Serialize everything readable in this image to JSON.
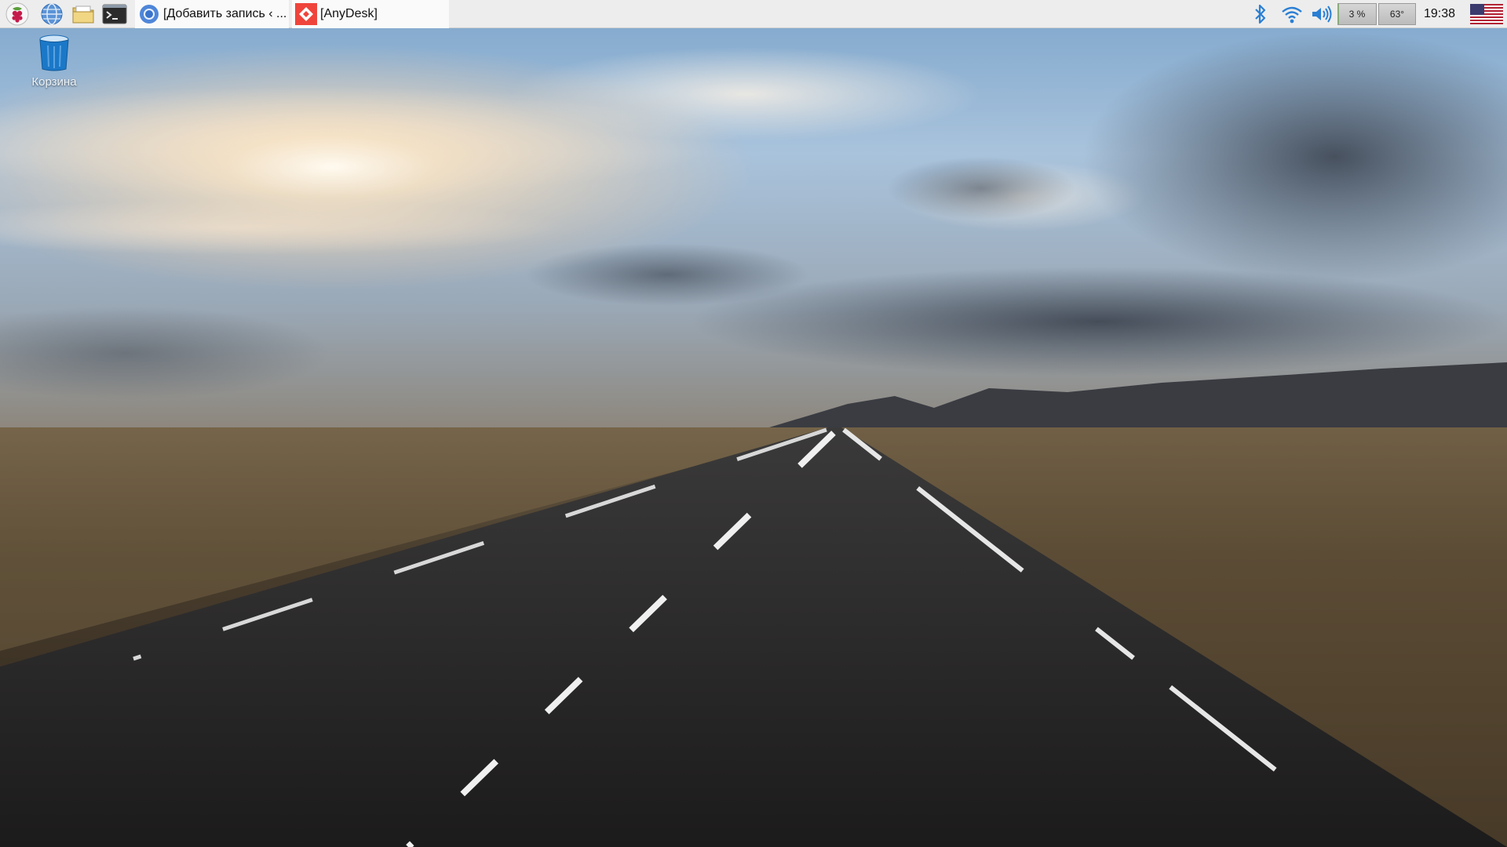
{
  "taskbar": {
    "launchers": [
      {
        "name": "raspberry-menu-icon"
      },
      {
        "name": "web-browser-icon"
      },
      {
        "name": "file-manager-icon"
      },
      {
        "name": "terminal-icon"
      }
    ],
    "tasks": [
      {
        "title": "[Добавить запись ‹ ...",
        "icon": "chromium-icon",
        "active": true
      },
      {
        "title": "[AnyDesk]",
        "icon": "anydesk-icon",
        "active": true
      }
    ],
    "tray": {
      "cpu_label": "3 %",
      "cpu_percent": 3,
      "temp_label": "63°",
      "clock": "19:38"
    }
  },
  "desktop": {
    "icons": [
      {
        "label": "Корзина",
        "icon": "trash-icon"
      }
    ]
  },
  "colors": {
    "taskbar_bg": "#ededed",
    "bluetooth": "#2a7fd4",
    "wifi": "#2a7fd4",
    "anydesk": "#ef443b"
  }
}
